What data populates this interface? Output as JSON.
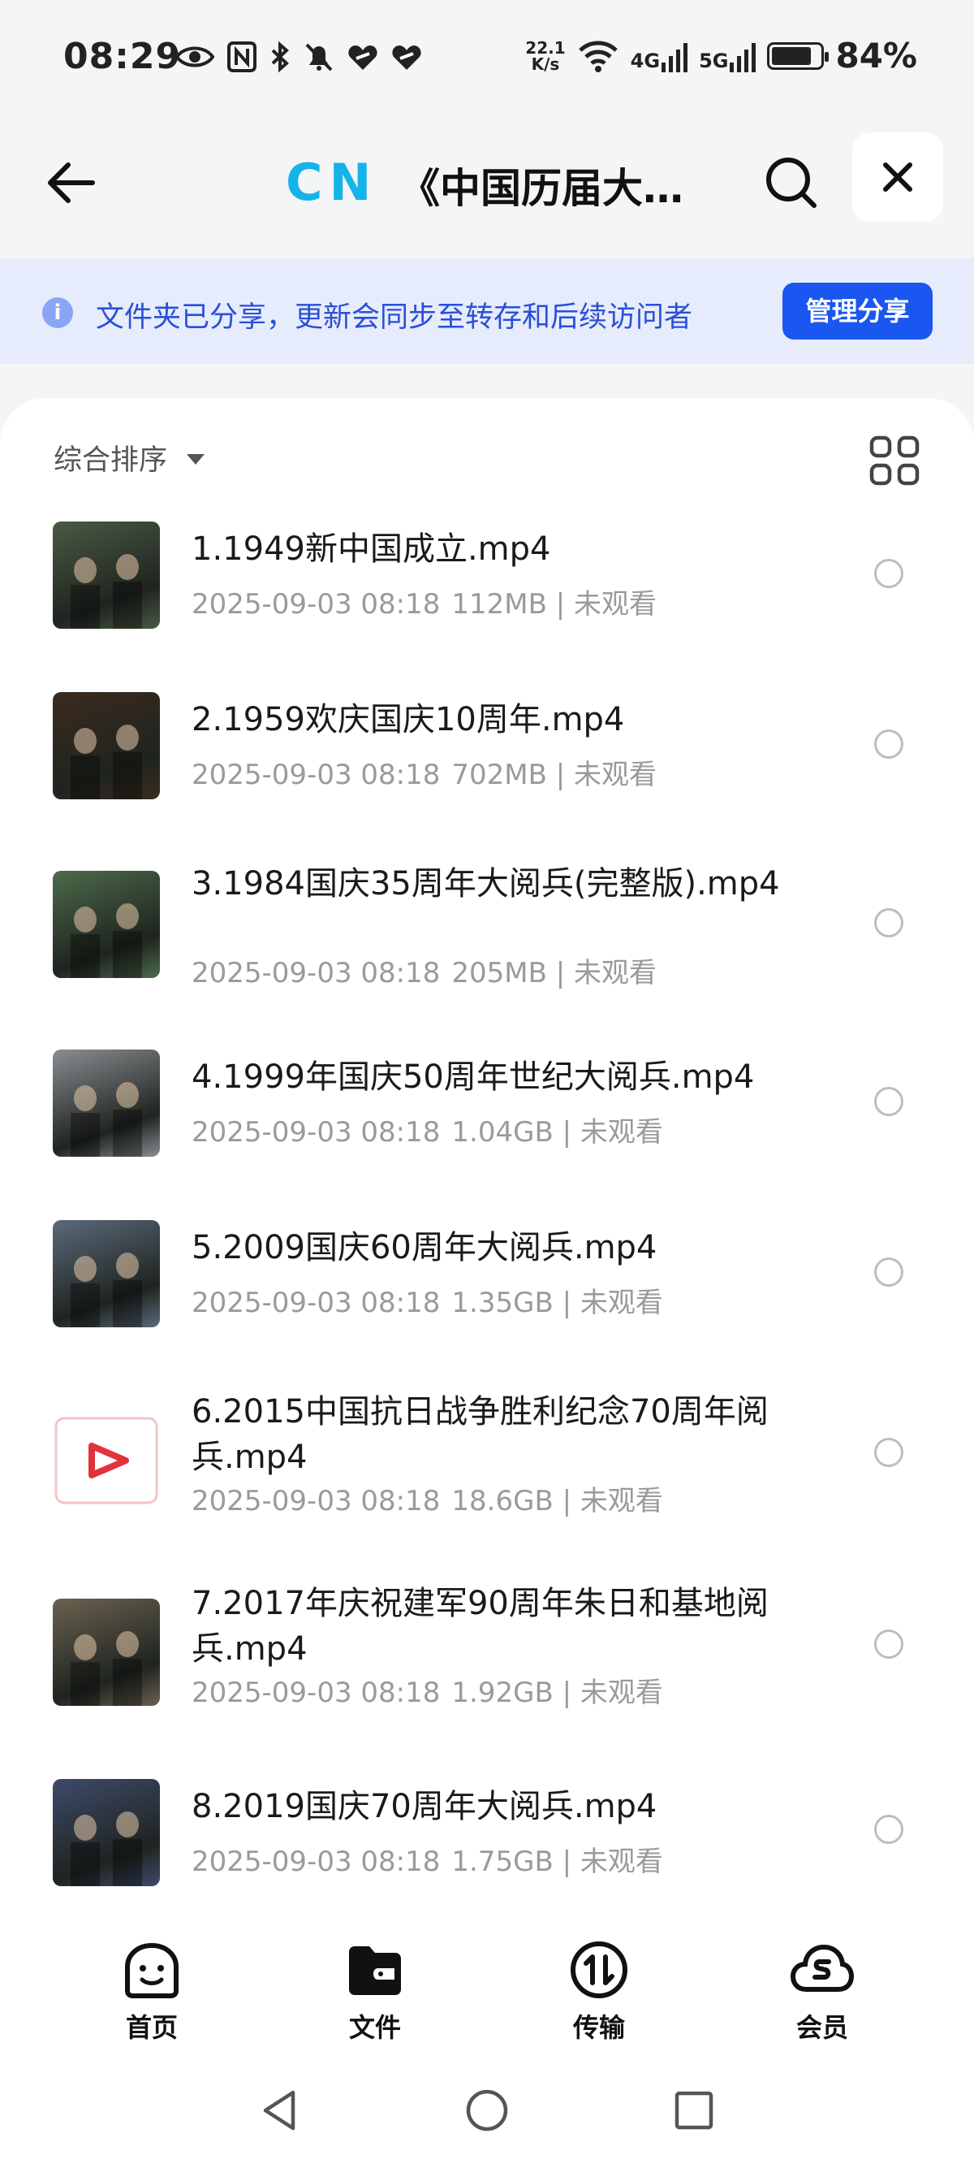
{
  "status_bar": {
    "time": "08:29",
    "net_speed_value": "22.1",
    "net_speed_unit": "K/s",
    "net_4g": "4G",
    "net_5g": "5G",
    "battery_percent": 84,
    "battery_label": "84%"
  },
  "header": {
    "logo_text": "CN",
    "title": "《中国历届大…"
  },
  "banner": {
    "message": "文件夹已分享，更新会同步至转存和后续访问者",
    "manage_label": "管理分享"
  },
  "list_controls": {
    "sort_label": "综合排序"
  },
  "files": [
    {
      "name": "1.1949新中国成立.mp4",
      "date": "2025-09-03 08:18",
      "size": "112MB",
      "status": "未观看",
      "thumb": "video-thumb-1949",
      "thumb_color": "#4a5a44"
    },
    {
      "name": "2.1959欢庆国庆10周年.mp4",
      "date": "2025-09-03 08:18",
      "size": "702MB",
      "status": "未观看",
      "thumb": "video-thumb-1959",
      "thumb_color": "#3b2a1e"
    },
    {
      "name": "3.1984国庆35周年大阅兵(完整版).mp4",
      "date": "2025-09-03 08:18",
      "size": "205MB",
      "status": "未观看",
      "thumb": "video-thumb-1984",
      "thumb_color": "#4d6a4a"
    },
    {
      "name": "4.1999年国庆50周年世纪大阅兵.mp4",
      "date": "2025-09-03 08:18",
      "size": "1.04GB",
      "status": "未观看",
      "thumb": "video-thumb-1999",
      "thumb_color": "#8a8e92"
    },
    {
      "name": "5.2009国庆60周年大阅兵.mp4",
      "date": "2025-09-03 08:18",
      "size": "1.35GB",
      "status": "未观看",
      "thumb": "video-thumb-2009",
      "thumb_color": "#5b6a7a"
    },
    {
      "name": "6.2015中国抗日战争胜利纪念70周年阅兵.mp4",
      "date": "2025-09-03 08:18",
      "size": "18.6GB",
      "status": "未观看",
      "thumb": "video-file-icon",
      "thumb_color": "#ffffff"
    },
    {
      "name": "7.2017年庆祝建军90周年朱日和基地阅兵.mp4",
      "date": "2025-09-03 08:18",
      "size": "1.92GB",
      "status": "未观看",
      "thumb": "video-thumb-2017",
      "thumb_color": "#6b6250"
    },
    {
      "name": "8.2019国庆70周年大阅兵.mp4",
      "date": "2025-09-03 08:18",
      "size": "1.75GB",
      "status": "未观看",
      "thumb": "video-thumb-2019",
      "thumb_color": "#3e4a6a"
    }
  ],
  "bottom_nav": [
    {
      "label": "首页",
      "icon": "home-smile-icon"
    },
    {
      "label": "文件",
      "icon": "folder-icon"
    },
    {
      "label": "传输",
      "icon": "transfer-icon"
    },
    {
      "label": "会员",
      "icon": "vip-cloud-icon"
    }
  ],
  "colors": {
    "accent": "#1a56f0",
    "banner_bg": "#e6ecfb",
    "banner_text": "#2a4fd8",
    "logo": "#16b3e8"
  }
}
